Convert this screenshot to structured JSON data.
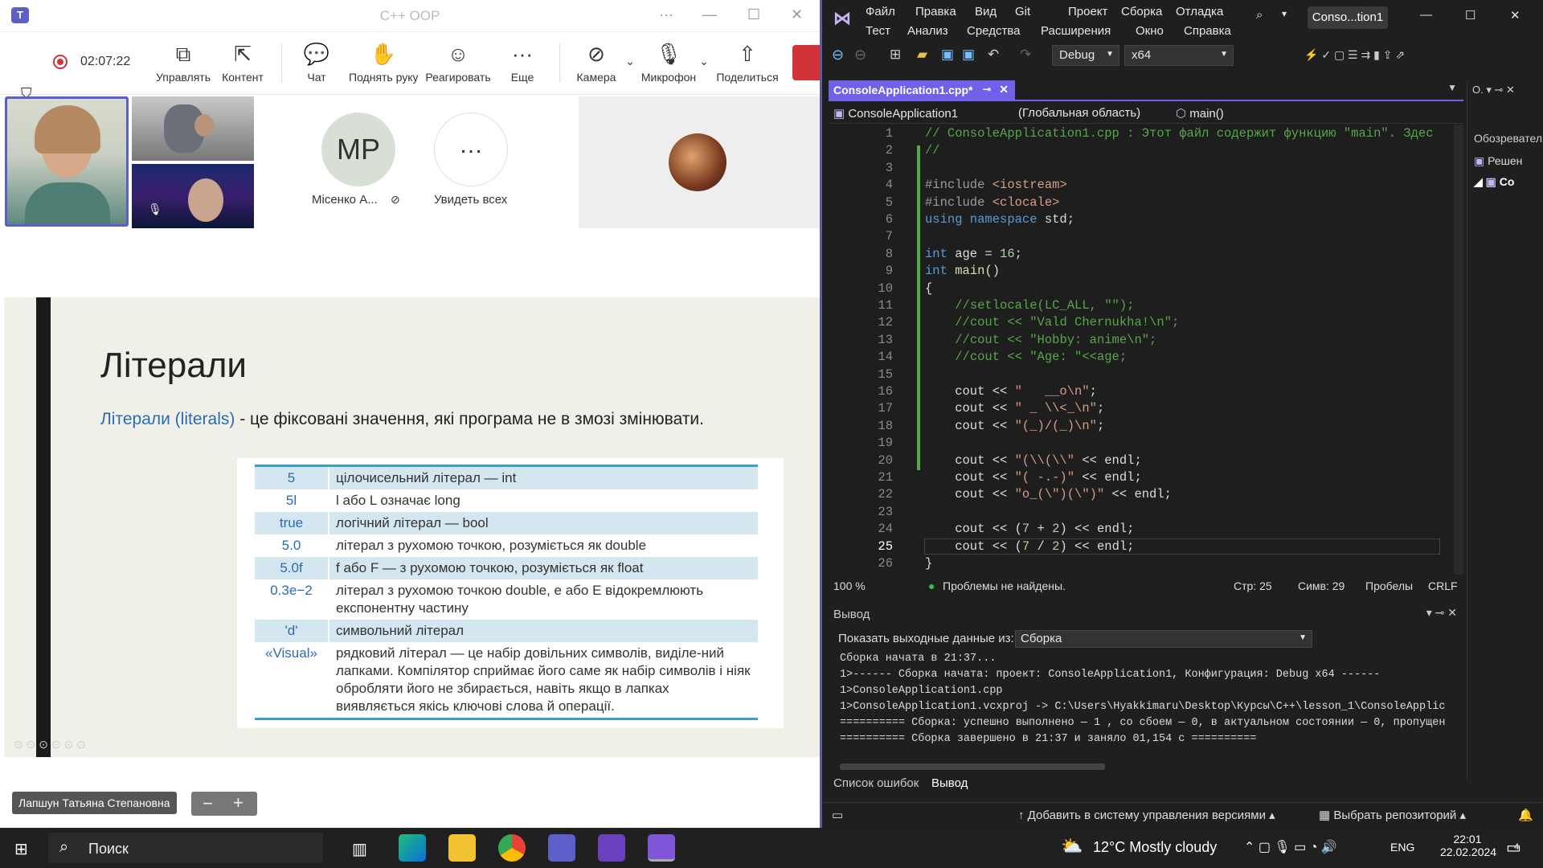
{
  "teams": {
    "window_title": "C++ OOP",
    "timer": "02:07:22",
    "toolbar": [
      {
        "label": "Управлять",
        "icon": "share-screen-icon"
      },
      {
        "label": "Контент",
        "icon": "content-icon"
      },
      {
        "label": "Чат",
        "icon": "chat-icon"
      },
      {
        "label": "Поднять руку",
        "icon": "raise-hand-icon"
      },
      {
        "label": "Реагировать",
        "icon": "react-icon"
      },
      {
        "label": "Еще",
        "icon": "more-icon"
      },
      {
        "label": "Камера",
        "icon": "camera-off-icon"
      },
      {
        "label": "Микрофон",
        "icon": "mic-off-icon"
      },
      {
        "label": "Поделиться",
        "icon": "share-icon"
      }
    ],
    "participants": {
      "mr_initials": "MP",
      "mr_name": "Місенко А...",
      "see_all": "Увидеть всех"
    },
    "slide": {
      "title": "Літерали",
      "definition_highlight": "Літерали (literals)",
      "definition_rest": " - це фіксовані значення, які програма не в змозі змінювати.",
      "rows": [
        {
          "k": "5",
          "v": "цілочисельний літерал — int",
          "s": true
        },
        {
          "k": "5l",
          "v": "l або L означає long",
          "s": false
        },
        {
          "k": "true",
          "v": "логічний літерал — bool",
          "s": true
        },
        {
          "k": "5.0",
          "v": "літерал з рухомою точкою, розуміється як double",
          "s": false
        },
        {
          "k": "5.0f",
          "v": "f або F — з рухомою точкою, розуміється як float",
          "s": true
        },
        {
          "k": "0.3e−2",
          "v": "літерал з рухомою точкою double, e або E відокремлюють експонентну частину",
          "s": false
        },
        {
          "k": "'d'",
          "v": "символьний літерал",
          "s": true
        },
        {
          "k": "«Visual»",
          "v": "рядковий літерал — це набір довільних символів, виділе-ний лапками. Компілятор сприймає його саме як набір символів і ніяк обробляти його не збирається, навіть якщо в лапках виявляється якісь ключові слова й операції.",
          "s": false
        }
      ]
    },
    "presenter_name": "Лапшун Татьяна Степановна"
  },
  "vs": {
    "menu_row1": [
      "Файл",
      "Правка",
      "Вид",
      "Git",
      "Проект",
      "Сборка",
      "Отладка"
    ],
    "menu_row2": [
      "Тест",
      "Анализ",
      "Средства",
      "Расширения",
      "Окно",
      "Справка"
    ],
    "window_title": "Conso...tion1",
    "config": "Debug",
    "platform": "x64",
    "tab": "ConsoleApplication1.cpp*",
    "nav_project": "ConsoleApplication1",
    "nav_scope": "(Глобальная область)",
    "nav_func": "main()",
    "code_lines": [
      {
        "n": "1",
        "html": "<span class='c-com'>// ConsoleApplication1.cpp : Этот файл содержит функцию \"main\". Здес</span>"
      },
      {
        "n": "2",
        "html": "<span class='c-com'>//</span>"
      },
      {
        "n": "3",
        "html": ""
      },
      {
        "n": "4",
        "html": "<span class='c-inc'>#include</span> <span class='c-str'>&lt;iostream&gt;</span>"
      },
      {
        "n": "5",
        "html": "<span class='c-inc'>#include</span> <span class='c-str'>&lt;clocale&gt;</span>"
      },
      {
        "n": "6",
        "html": "<span class='c-kw'>using namespace</span> std;"
      },
      {
        "n": "7",
        "html": ""
      },
      {
        "n": "8",
        "html": "<span class='c-kw'>int</span> age = <span class='c-num'>16</span>;"
      },
      {
        "n": "9",
        "html": "<span class='c-kw'>int</span> <span class='c-fn'>main</span>()"
      },
      {
        "n": "10",
        "html": "{"
      },
      {
        "n": "11",
        "html": "    <span class='c-com'>//setlocale(LC_ALL, \"\");</span>"
      },
      {
        "n": "12",
        "html": "    <span class='c-com'>//cout &lt;&lt; \"Vald Chernukha!\\n\";</span>"
      },
      {
        "n": "13",
        "html": "    <span class='c-com'>//cout &lt;&lt; \"Hobby: anime\\n\";</span>"
      },
      {
        "n": "14",
        "html": "    <span class='c-com'>//cout &lt;&lt; \"Age: \"&lt;&lt;age;</span>"
      },
      {
        "n": "15",
        "html": ""
      },
      {
        "n": "16",
        "html": "    cout &lt;&lt; <span class='c-str'>\"   __o\\n\"</span>;"
      },
      {
        "n": "17",
        "html": "    cout &lt;&lt; <span class='c-str'>\" _ \\\\&lt;_\\n\"</span>;"
      },
      {
        "n": "18",
        "html": "    cout &lt;&lt; <span class='c-str'>\"(_)/(_)\\n\"</span>;"
      },
      {
        "n": "19",
        "html": ""
      },
      {
        "n": "20",
        "html": "    cout &lt;&lt; <span class='c-str'>\"(\\\\(\\\\\"</span> &lt;&lt; endl;"
      },
      {
        "n": "21",
        "html": "    cout &lt;&lt; <span class='c-str'>\"( -.-)\"</span> &lt;&lt; endl;"
      },
      {
        "n": "22",
        "html": "    cout &lt;&lt; <span class='c-str'>\"o_(\\\")(\\\")\"</span> &lt;&lt; endl;"
      },
      {
        "n": "23",
        "html": ""
      },
      {
        "n": "24",
        "html": "    cout &lt;&lt; (<span class='c-num'>7</span> + <span class='c-num'>2</span>) &lt;&lt; endl;"
      },
      {
        "n": "25",
        "html": "    cout &lt;&lt; (<span class='c-num'>7</span> / <span class='c-num'>2</span>) &lt;&lt; endl;"
      },
      {
        "n": "26",
        "html": "}"
      },
      {
        "n": "27",
        "html": ""
      }
    ],
    "zoom": "100 %",
    "problems": "Проблемы не найдены.",
    "line": "Стр: 25",
    "col": "Симв: 29",
    "spaces": "Пробелы",
    "eol": "CRLF",
    "output_title": "Вывод",
    "output_from_label": "Показать выходные данные из:",
    "output_source": "Сборка",
    "output_lines": [
      "Сборка начата в 21:37...",
      "1>------ Сборка начата: проект: ConsoleApplication1, Конфигурация: Debug x64 ------",
      "1>ConsoleApplication1.cpp",
      "1>ConsoleApplication1.vcxproj -> C:\\Users\\Hyakkimaru\\Desktop\\Курсы\\C++\\lesson_1\\ConsoleApplic",
      "========== Сборка: успешно выполнено — 1 , со сбоем — 0, в актуальном состоянии — 0, пропущен",
      "========== Сборка завершено в 21:37 и заняло 01,154 с =========="
    ],
    "bottom_tabs": [
      "Список ошибок",
      "Вывод"
    ],
    "add_vc": "Добавить в систему управления версиями",
    "select_repo": "Выбрать репозиторий",
    "side_title": "Обозревател",
    "side_item": "Решен",
    "side_item2": "Co"
  },
  "taskbar": {
    "search": "Поиск",
    "weather": "12°C  Mostly cloudy",
    "lang": "ENG",
    "time": "22:01",
    "date": "22.02.2024",
    "notif_count": "4"
  }
}
